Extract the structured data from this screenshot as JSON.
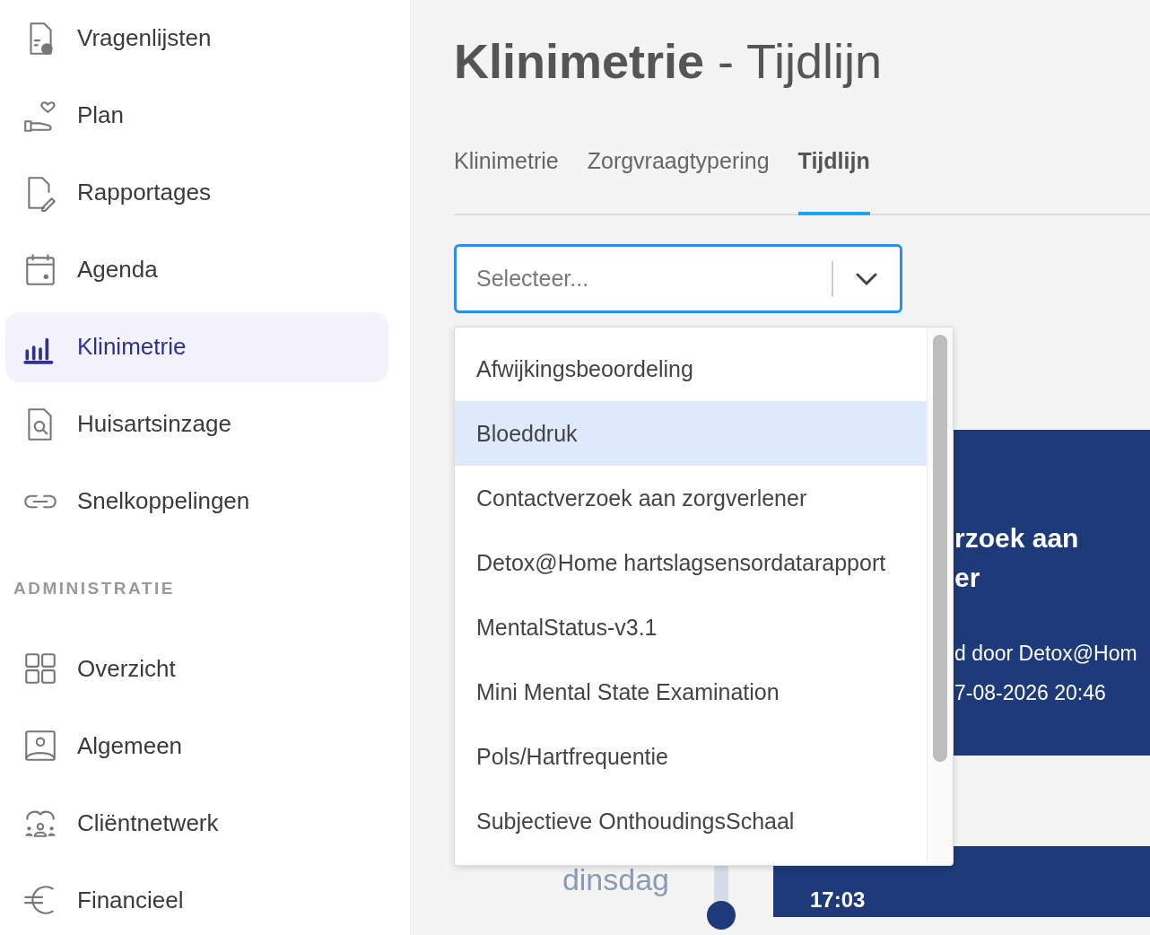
{
  "sidebar": {
    "groups": [
      {
        "items": [
          {
            "label": "Vragenlijsten",
            "selected": false
          },
          {
            "label": "Plan",
            "selected": false
          },
          {
            "label": "Rapportages",
            "selected": false
          },
          {
            "label": "Agenda",
            "selected": false
          },
          {
            "label": "Klinimetrie",
            "selected": true
          },
          {
            "label": "Huisartsinzage",
            "selected": false
          },
          {
            "label": "Snelkoppelingen",
            "selected": false
          }
        ]
      },
      {
        "heading": "ADMINISTRATIE",
        "items": [
          {
            "label": "Overzicht",
            "selected": false
          },
          {
            "label": "Algemeen",
            "selected": false
          },
          {
            "label": "Cliëntnetwerk",
            "selected": false
          },
          {
            "label": "Financieel",
            "selected": false
          }
        ]
      }
    ]
  },
  "page": {
    "title": "**Klinimetrie** - Tijdlijn"
  },
  "tabs": [
    {
      "label": "Klinimetrie",
      "selected": false
    },
    {
      "label": "Zorgvraagtypering",
      "selected": false
    },
    {
      "label": "Tijdlijn",
      "selected": true
    }
  ],
  "select": {
    "placeholder": "Selecteer...",
    "expanded": true,
    "options": [
      {
        "label": "Afwijkingsbeoordeling",
        "highlighted": false
      },
      {
        "label": "Bloeddruk",
        "highlighted": true
      },
      {
        "label": "Contactverzoek aan zorgverlener",
        "highlighted": false
      },
      {
        "label": "Detox@Home hartslagsensordatarapport",
        "highlighted": false
      },
      {
        "label": "MentalStatus-v3.1",
        "highlighted": false
      },
      {
        "label": "Mini Mental State Examination",
        "highlighted": false
      },
      {
        "label": "Pols/Hartfrequentie",
        "highlighted": false
      },
      {
        "label": "Subjectieve OnthoudingsSchaal",
        "highlighted": false
      }
    ]
  },
  "timeline": {
    "cards": [
      {
        "title_lines": [
          "rzoek aan",
          "er"
        ],
        "lines": [
          "d door Detox@Hom",
          "7-08-2026 20:46"
        ]
      }
    ],
    "entries": [
      {
        "weekday": "dinsdag",
        "time": "17:03"
      }
    ]
  }
}
